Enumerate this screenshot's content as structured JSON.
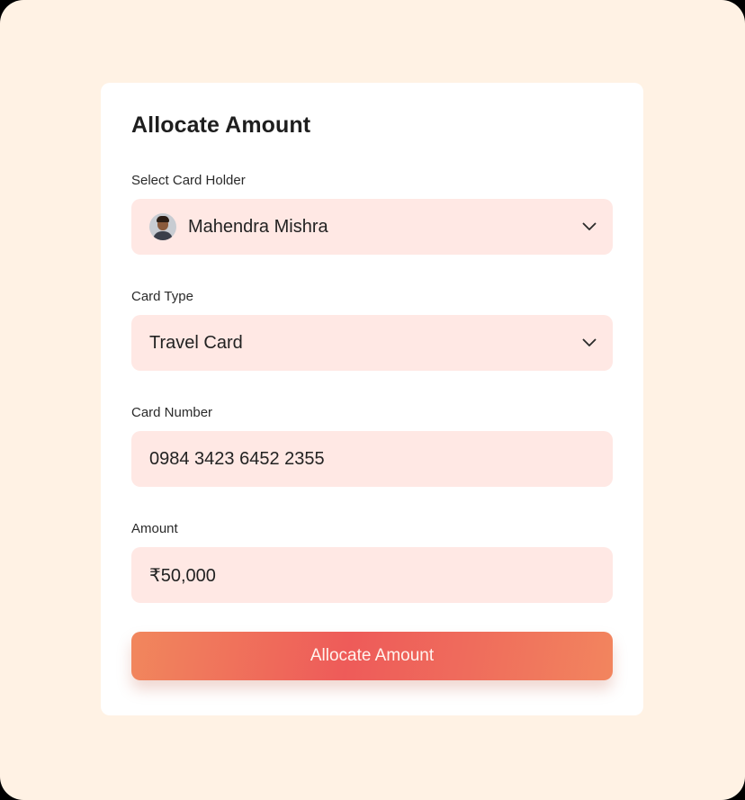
{
  "form": {
    "title": "Allocate Amount",
    "card_holder": {
      "label": "Select Card Holder",
      "value": "Mahendra Mishra"
    },
    "card_type": {
      "label": "Card Type",
      "value": "Travel Card"
    },
    "card_number": {
      "label": "Card Number",
      "value": "0984 3423 6452 2355"
    },
    "amount": {
      "label": "Amount",
      "value": "₹50,000"
    },
    "submit_label": "Allocate Amount"
  },
  "colors": {
    "page_background": "#fff2e4",
    "card_background": "#ffffff",
    "field_background": "#ffe8e4",
    "button_gradient_start": "#f1875d",
    "button_gradient_mid": "#ee5b59",
    "text_primary": "#1e1e1e"
  },
  "icons": {
    "dropdown": "chevron-down-icon",
    "avatar": "avatar"
  }
}
